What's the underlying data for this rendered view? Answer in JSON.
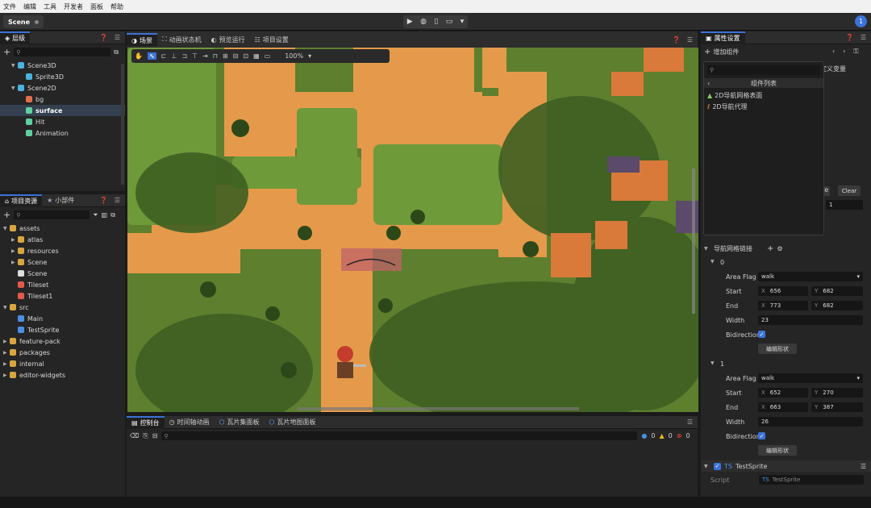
{
  "menu": [
    "文件",
    "编辑",
    "工具",
    "开发者",
    "面板",
    "帮助"
  ],
  "toolbar": {
    "scene_tab": "Scene",
    "play": "▶",
    "globe": "◍",
    "phone": "▯",
    "monitor": "▭",
    "more": "▾",
    "notif_count": "1"
  },
  "hierarchy": {
    "tab": "层级",
    "search_placeholder": "",
    "items": [
      {
        "label": "Scene3D",
        "depth": 1,
        "expanded": true,
        "icon": "cube-icon"
      },
      {
        "label": "Sprite3D",
        "depth": 2,
        "icon": "cube-icon"
      },
      {
        "label": "Scene2D",
        "depth": 1,
        "expanded": true,
        "icon": "cube-icon"
      },
      {
        "label": "bg",
        "depth": 2,
        "icon": "image-icon"
      },
      {
        "label": "surface",
        "depth": 2,
        "icon": "sprite-icon",
        "selected": true
      },
      {
        "label": "Hit",
        "depth": 2,
        "icon": "sprite-icon"
      },
      {
        "label": "Animation",
        "depth": 2,
        "icon": "animation-icon"
      }
    ]
  },
  "assets": {
    "tabs": [
      "项目资源",
      "小部件"
    ],
    "items": [
      {
        "label": "assets",
        "depth": 0,
        "expanded": true,
        "icon": "folder-icon"
      },
      {
        "label": "atlas",
        "depth": 1,
        "icon": "folder-icon"
      },
      {
        "label": "resources",
        "depth": 1,
        "icon": "folder-icon"
      },
      {
        "label": "Scene",
        "depth": 1,
        "icon": "folder-icon"
      },
      {
        "label": "Scene",
        "depth": 1,
        "icon": "scene-icon",
        "leaf": true
      },
      {
        "label": "Tileset",
        "depth": 1,
        "icon": "tileset-icon",
        "leaf": true
      },
      {
        "label": "Tileset1",
        "depth": 1,
        "icon": "tileset-icon",
        "leaf": true
      },
      {
        "label": "src",
        "depth": 0,
        "expanded": true,
        "icon": "folder-icon"
      },
      {
        "label": "Main",
        "depth": 1,
        "icon": "ts-icon",
        "leaf": true
      },
      {
        "label": "TestSprite",
        "depth": 1,
        "icon": "ts-icon",
        "leaf": true
      },
      {
        "label": "feature-pack",
        "depth": 0,
        "icon": "folder-icon"
      },
      {
        "label": "packages",
        "depth": 0,
        "icon": "folder-icon"
      },
      {
        "label": "internal",
        "depth": 0,
        "icon": "folder-icon"
      },
      {
        "label": "editor-widgets",
        "depth": 0,
        "icon": "folder-icon"
      }
    ]
  },
  "center": {
    "tabs": [
      "场景",
      "动画状态机",
      "预览运行",
      "项目设置"
    ],
    "zoom": "100%"
  },
  "console": {
    "tabs": [
      "控制台",
      "时间轴动画",
      "瓦片集面板",
      "瓦片地图面板"
    ],
    "counts": {
      "info": "0",
      "warn": "0",
      "error": "0"
    }
  },
  "inspector": {
    "tab": "属性设置",
    "add_component": "增加组件",
    "custom_var": "定义变量",
    "popup": {
      "title": "组件列表",
      "items": [
        "2D导航网格表面",
        "2D导航代理"
      ]
    },
    "bake": "ake",
    "clear": "Clear",
    "one_val": "1",
    "nav_links": "导航网格链接",
    "links": [
      {
        "index": "0",
        "area_flag": "walk",
        "start_x": "656",
        "start_y": "682",
        "end_x": "773",
        "end_y": "682",
        "width": "23"
      },
      {
        "index": "1",
        "area_flag": "walk",
        "start_x": "652",
        "start_y": "270",
        "end_x": "663",
        "end_y": "387",
        "width": "26"
      }
    ],
    "labels": {
      "area_flag": "Area Flag",
      "start": "Start",
      "end": "End",
      "width": "Width",
      "bidirectional": "Bidirectiona",
      "edit_shape": "编辑形状",
      "x": "X",
      "y": "Y"
    },
    "script_comp": "TestSprite",
    "script_label": "Script",
    "script_value": "TestSprite"
  }
}
